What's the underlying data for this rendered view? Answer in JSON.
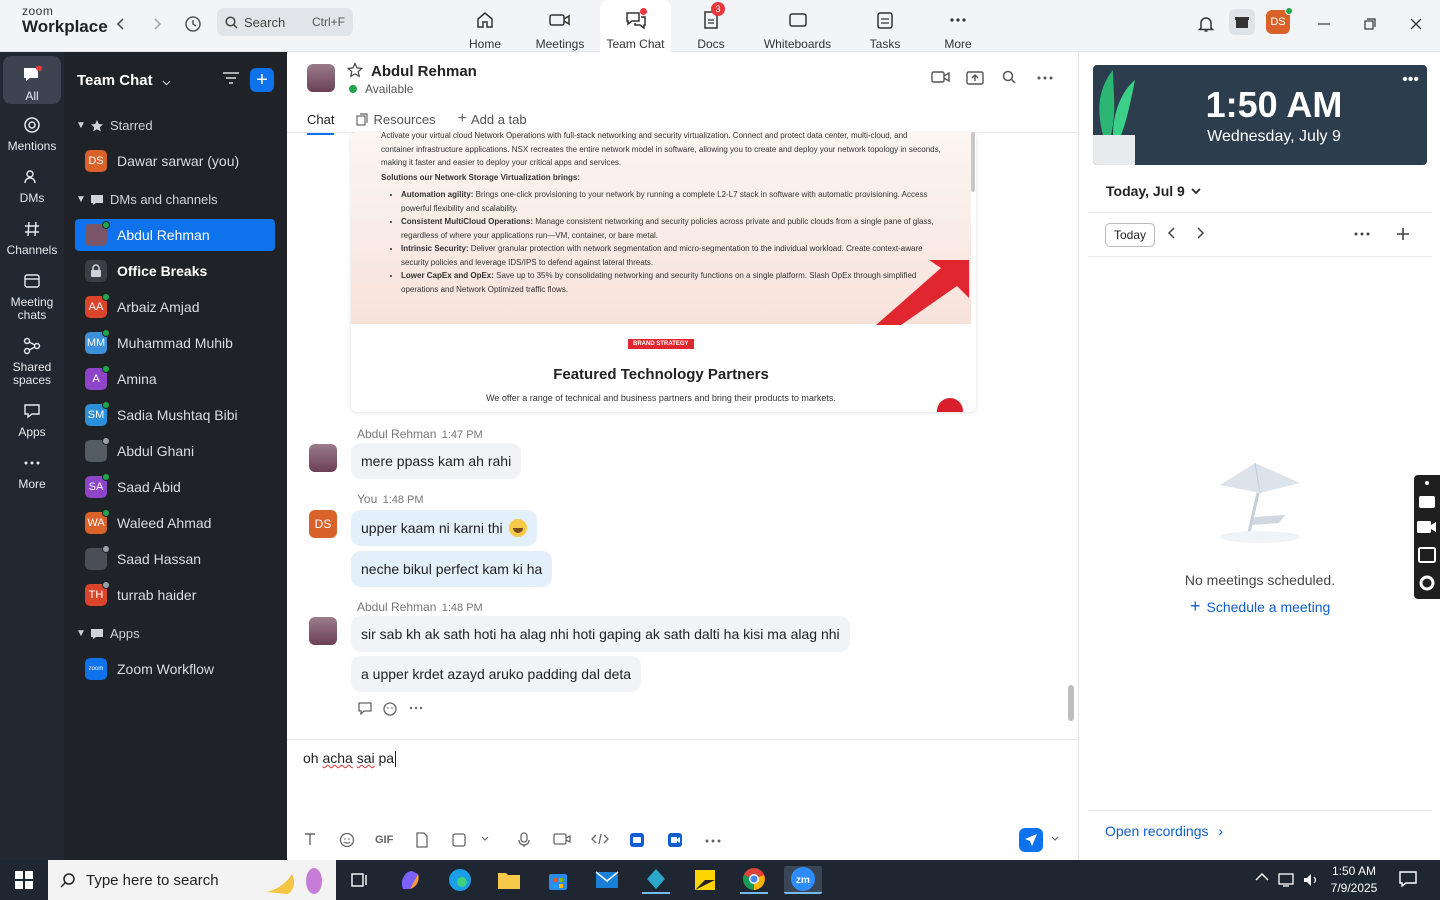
{
  "app": {
    "logo_line1": "zoom",
    "logo_line2": "Workplace",
    "search_placeholder": "Search",
    "search_shortcut": "Ctrl+F",
    "nav": [
      {
        "label": "Home"
      },
      {
        "label": "Meetings"
      },
      {
        "label": "Team Chat"
      },
      {
        "label": "Docs",
        "badge": "3"
      },
      {
        "label": "Whiteboards"
      },
      {
        "label": "Tasks"
      },
      {
        "label": "More"
      }
    ],
    "profile_initials": "DS"
  },
  "rail": [
    {
      "label": "All"
    },
    {
      "label": "Mentions"
    },
    {
      "label": "DMs"
    },
    {
      "label": "Channels"
    },
    {
      "label": "Meeting chats"
    },
    {
      "label": "Shared spaces"
    },
    {
      "label": "Apps"
    },
    {
      "label": "More"
    }
  ],
  "sidebar": {
    "title": "Team Chat",
    "sections": {
      "starred": "Starred",
      "dms": "DMs and channels",
      "apps": "Apps"
    },
    "starred_items": [
      {
        "initials": "DS",
        "name": "Dawar sarwar (you)",
        "color": "#d9622b"
      }
    ],
    "items": [
      {
        "initials": "",
        "name": "Abdul Rehman",
        "color": "#7a5568",
        "status": "#1fa64a"
      },
      {
        "initials": "",
        "name": "Office Breaks",
        "color": "#3a3f46"
      },
      {
        "initials": "AA",
        "name": "Arbaiz Amjad",
        "color": "#d9442b",
        "status": "#1fa64a"
      },
      {
        "initials": "MM",
        "name": "Muhammad Muhib",
        "color": "#3d8fd9",
        "status": "#1fa64a"
      },
      {
        "initials": "A",
        "name": "Amina",
        "color": "#8e44c9",
        "status": "#1fa64a"
      },
      {
        "initials": "SM",
        "name": "Sadia Mushtaq Bibi",
        "color": "#2b8fd9",
        "status": "#1fa64a"
      },
      {
        "initials": "",
        "name": "Abdul Ghani",
        "color": "#555b63",
        "status": "#9aa0a6"
      },
      {
        "initials": "SA",
        "name": "Saad Abid",
        "color": "#8e44c9",
        "status": "#1fa64a"
      },
      {
        "initials": "WA",
        "name": "Waleed Ahmad",
        "color": "#d9622b",
        "status": "#1fa64a"
      },
      {
        "initials": "",
        "name": "Saad Hassan",
        "color": "#4a4f57",
        "status": "#9aa0a6"
      },
      {
        "initials": "TH",
        "name": "turrab haider",
        "color": "#d9442b",
        "status": "#9aa0a6"
      }
    ],
    "app_items": [
      {
        "initials": "zoom",
        "name": "Zoom Workflow",
        "color": "#0e72ed"
      }
    ]
  },
  "chat": {
    "name": "Abdul Rehman",
    "status": "Available",
    "tabs": {
      "chat": "Chat",
      "resources": "Resources",
      "add": "Add a tab"
    },
    "card": {
      "intro": "Activate your virtual cloud Network Operations with full-stack networking and security virtualization. Connect and protect data center, multi-cloud, and container infrastructure applications. NSX recreates the entire network model in software, allowing you to create and deploy your network topology in seconds, making it faster and easier to deploy your critical apps and services.",
      "subhead": "Solutions our Network Storage Virtualization brings:",
      "bullets": [
        {
          "bold": "Automation agility:",
          "text": " Brings one-click provisioning to your network by running a complete L2-L7 stack in software with automatic provisioning. Access powerful flexibility and scalability."
        },
        {
          "bold": "Consistent MultiCloud Operations:",
          "text": " Manage consistent networking and security policies across private and public clouds from a single pane of glass, regardless of where your applications run—VM, container, or bare metal."
        },
        {
          "bold": "Intrinsic Security:",
          "text": " Deliver granular protection with network segmentation and micro-segmentation to the individual workload. Create context-aware security policies and leverage IDS/IPS to defend against lateral threats."
        },
        {
          "bold": "Lower CapEx and OpEx:",
          "text": " Save up to 35% by consolidating networking and security functions on a single platform. Slash OpEx through simplified operations and Network Optimized traffic flows."
        }
      ],
      "tag": "BRAND STRATEGY",
      "title": "Featured Technology Partners",
      "desc": "We offer a range of technical and business partners and bring their products to markets."
    },
    "messages": [
      {
        "sender": "Abdul Rehman",
        "time": "1:47 PM",
        "texts": [
          "mere ppass kam ah rahi"
        ]
      },
      {
        "sender": "You",
        "time": "1:48 PM",
        "initials": "DS",
        "texts": [
          "upper kaam ni karni thi",
          "neche bikul perfect kam ki ha"
        ]
      },
      {
        "sender": "Abdul Rehman",
        "time": "1:48 PM",
        "texts": [
          "sir sab kh ak sath hoti ha alag nhi hoti gaping ak sath dalti ha kisi ma alag nhi",
          "a upper krdet azayd aruko padding dal deta"
        ]
      }
    ],
    "composer_words": [
      "oh",
      "acha",
      "sai",
      "pa"
    ],
    "toolbar_gif": "GIF"
  },
  "calendar": {
    "time": "1:50 AM",
    "date": "Wednesday, July 9",
    "today_label": "Today, Jul 9",
    "today_button": "Today",
    "empty": "No meetings scheduled.",
    "schedule": "Schedule a meeting",
    "recordings": "Open recordings"
  },
  "taskbar": {
    "search_placeholder": "Type here to search",
    "time": "1:50 AM",
    "date": "7/9/2025"
  }
}
